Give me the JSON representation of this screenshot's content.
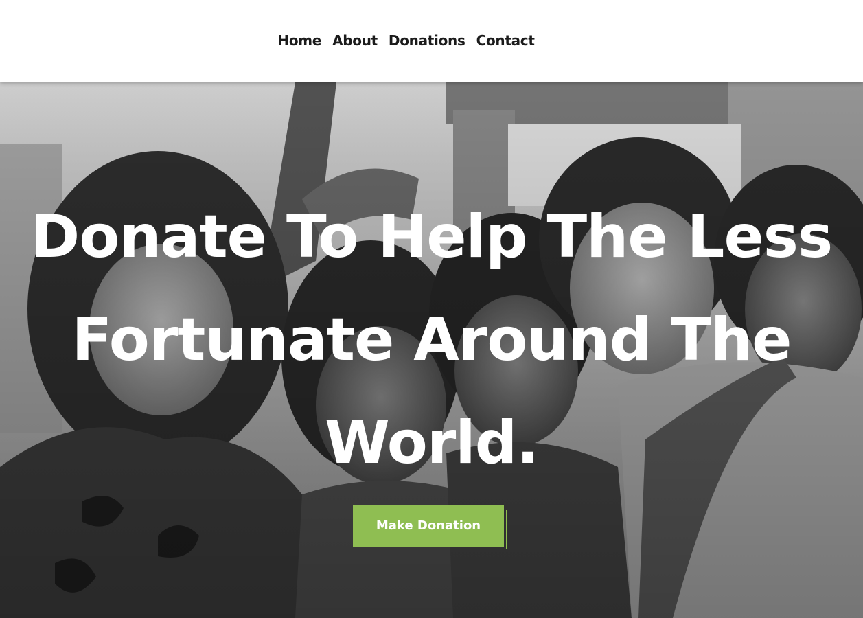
{
  "nav": {
    "items": [
      {
        "label": "Home"
      },
      {
        "label": "About"
      },
      {
        "label": "Donations"
      },
      {
        "label": "Contact"
      }
    ]
  },
  "hero": {
    "headline_lines": [
      "Donate To Help The Less",
      "Fortunate Around The",
      "World."
    ],
    "cta_label": "Make Donation"
  },
  "colors": {
    "accent": "#8fbe52",
    "nav_text": "#1b1b1b",
    "header_bg": "#ffffff",
    "headline_text": "#ffffff"
  }
}
